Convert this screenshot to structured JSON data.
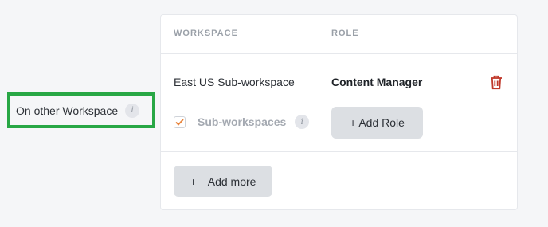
{
  "side_label": {
    "text": "On other Workspace",
    "info_icon": "info-icon"
  },
  "table": {
    "columns": {
      "workspace": "WORKSPACE",
      "role": "ROLE"
    },
    "rows": [
      {
        "workspace": "East US Sub-workspace",
        "role": "Content Manager",
        "subworkspaces_label": "Sub-workspaces",
        "subworkspaces_checked": true,
        "add_role_label": "+ Add Role"
      }
    ],
    "add_more_label": "Add more",
    "add_more_plus": "+"
  },
  "colors": {
    "highlight": "#28a745",
    "trash": "#c0392b",
    "checkmark": "#e8833a",
    "button_bg": "#dcdfe3"
  }
}
